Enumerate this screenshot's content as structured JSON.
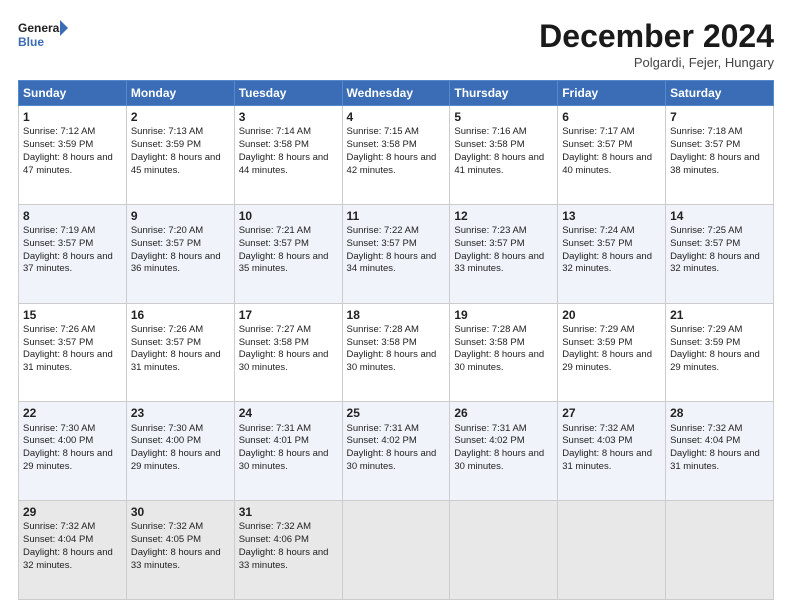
{
  "header": {
    "logo_line1": "General",
    "logo_line2": "Blue",
    "month": "December 2024",
    "location": "Polgardi, Fejer, Hungary"
  },
  "days_of_week": [
    "Sunday",
    "Monday",
    "Tuesday",
    "Wednesday",
    "Thursday",
    "Friday",
    "Saturday"
  ],
  "weeks": [
    [
      {
        "day": "1",
        "rise": "7:12 AM",
        "set": "3:59 PM",
        "daylight": "8 hours and 47 minutes."
      },
      {
        "day": "2",
        "rise": "7:13 AM",
        "set": "3:59 PM",
        "daylight": "8 hours and 45 minutes."
      },
      {
        "day": "3",
        "rise": "7:14 AM",
        "set": "3:58 PM",
        "daylight": "8 hours and 44 minutes."
      },
      {
        "day": "4",
        "rise": "7:15 AM",
        "set": "3:58 PM",
        "daylight": "8 hours and 42 minutes."
      },
      {
        "day": "5",
        "rise": "7:16 AM",
        "set": "3:58 PM",
        "daylight": "8 hours and 41 minutes."
      },
      {
        "day": "6",
        "rise": "7:17 AM",
        "set": "3:57 PM",
        "daylight": "8 hours and 40 minutes."
      },
      {
        "day": "7",
        "rise": "7:18 AM",
        "set": "3:57 PM",
        "daylight": "8 hours and 38 minutes."
      }
    ],
    [
      {
        "day": "8",
        "rise": "7:19 AM",
        "set": "3:57 PM",
        "daylight": "8 hours and 37 minutes."
      },
      {
        "day": "9",
        "rise": "7:20 AM",
        "set": "3:57 PM",
        "daylight": "8 hours and 36 minutes."
      },
      {
        "day": "10",
        "rise": "7:21 AM",
        "set": "3:57 PM",
        "daylight": "8 hours and 35 minutes."
      },
      {
        "day": "11",
        "rise": "7:22 AM",
        "set": "3:57 PM",
        "daylight": "8 hours and 34 minutes."
      },
      {
        "day": "12",
        "rise": "7:23 AM",
        "set": "3:57 PM",
        "daylight": "8 hours and 33 minutes."
      },
      {
        "day": "13",
        "rise": "7:24 AM",
        "set": "3:57 PM",
        "daylight": "8 hours and 32 minutes."
      },
      {
        "day": "14",
        "rise": "7:25 AM",
        "set": "3:57 PM",
        "daylight": "8 hours and 32 minutes."
      }
    ],
    [
      {
        "day": "15",
        "rise": "7:26 AM",
        "set": "3:57 PM",
        "daylight": "8 hours and 31 minutes."
      },
      {
        "day": "16",
        "rise": "7:26 AM",
        "set": "3:57 PM",
        "daylight": "8 hours and 31 minutes."
      },
      {
        "day": "17",
        "rise": "7:27 AM",
        "set": "3:58 PM",
        "daylight": "8 hours and 30 minutes."
      },
      {
        "day": "18",
        "rise": "7:28 AM",
        "set": "3:58 PM",
        "daylight": "8 hours and 30 minutes."
      },
      {
        "day": "19",
        "rise": "7:28 AM",
        "set": "3:58 PM",
        "daylight": "8 hours and 30 minutes."
      },
      {
        "day": "20",
        "rise": "7:29 AM",
        "set": "3:59 PM",
        "daylight": "8 hours and 29 minutes."
      },
      {
        "day": "21",
        "rise": "7:29 AM",
        "set": "3:59 PM",
        "daylight": "8 hours and 29 minutes."
      }
    ],
    [
      {
        "day": "22",
        "rise": "7:30 AM",
        "set": "4:00 PM",
        "daylight": "8 hours and 29 minutes."
      },
      {
        "day": "23",
        "rise": "7:30 AM",
        "set": "4:00 PM",
        "daylight": "8 hours and 29 minutes."
      },
      {
        "day": "24",
        "rise": "7:31 AM",
        "set": "4:01 PM",
        "daylight": "8 hours and 30 minutes."
      },
      {
        "day": "25",
        "rise": "7:31 AM",
        "set": "4:02 PM",
        "daylight": "8 hours and 30 minutes."
      },
      {
        "day": "26",
        "rise": "7:31 AM",
        "set": "4:02 PM",
        "daylight": "8 hours and 30 minutes."
      },
      {
        "day": "27",
        "rise": "7:32 AM",
        "set": "4:03 PM",
        "daylight": "8 hours and 31 minutes."
      },
      {
        "day": "28",
        "rise": "7:32 AM",
        "set": "4:04 PM",
        "daylight": "8 hours and 31 minutes."
      }
    ],
    [
      {
        "day": "29",
        "rise": "7:32 AM",
        "set": "4:04 PM",
        "daylight": "8 hours and 32 minutes."
      },
      {
        "day": "30",
        "rise": "7:32 AM",
        "set": "4:05 PM",
        "daylight": "8 hours and 33 minutes."
      },
      {
        "day": "31",
        "rise": "7:32 AM",
        "set": "4:06 PM",
        "daylight": "8 hours and 33 minutes."
      },
      null,
      null,
      null,
      null
    ]
  ],
  "labels": {
    "sunrise": "Sunrise:",
    "sunset": "Sunset:",
    "daylight": "Daylight:"
  }
}
